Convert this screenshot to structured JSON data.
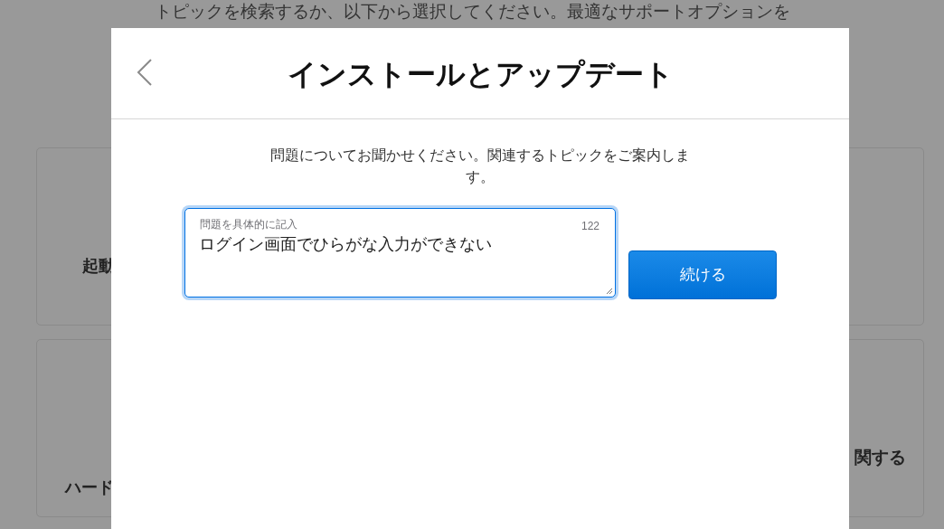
{
  "background": {
    "intro_line": "トピックを検索するか、以下から選択してください。最適なサポートオプションを",
    "left_cards": [
      {
        "label": "起動"
      },
      {
        "label": "ハード"
      }
    ],
    "right_cards": [
      {
        "label": "関する"
      }
    ]
  },
  "dialog": {
    "title": "インストールとアップデート",
    "description": "問題についてお聞かせください。関連するトピックをご案内します。",
    "field": {
      "label": "問題を具体的に記入",
      "count": "122",
      "value": "ログイン画面でひらがな入力ができない"
    },
    "continue_button": "続ける"
  }
}
